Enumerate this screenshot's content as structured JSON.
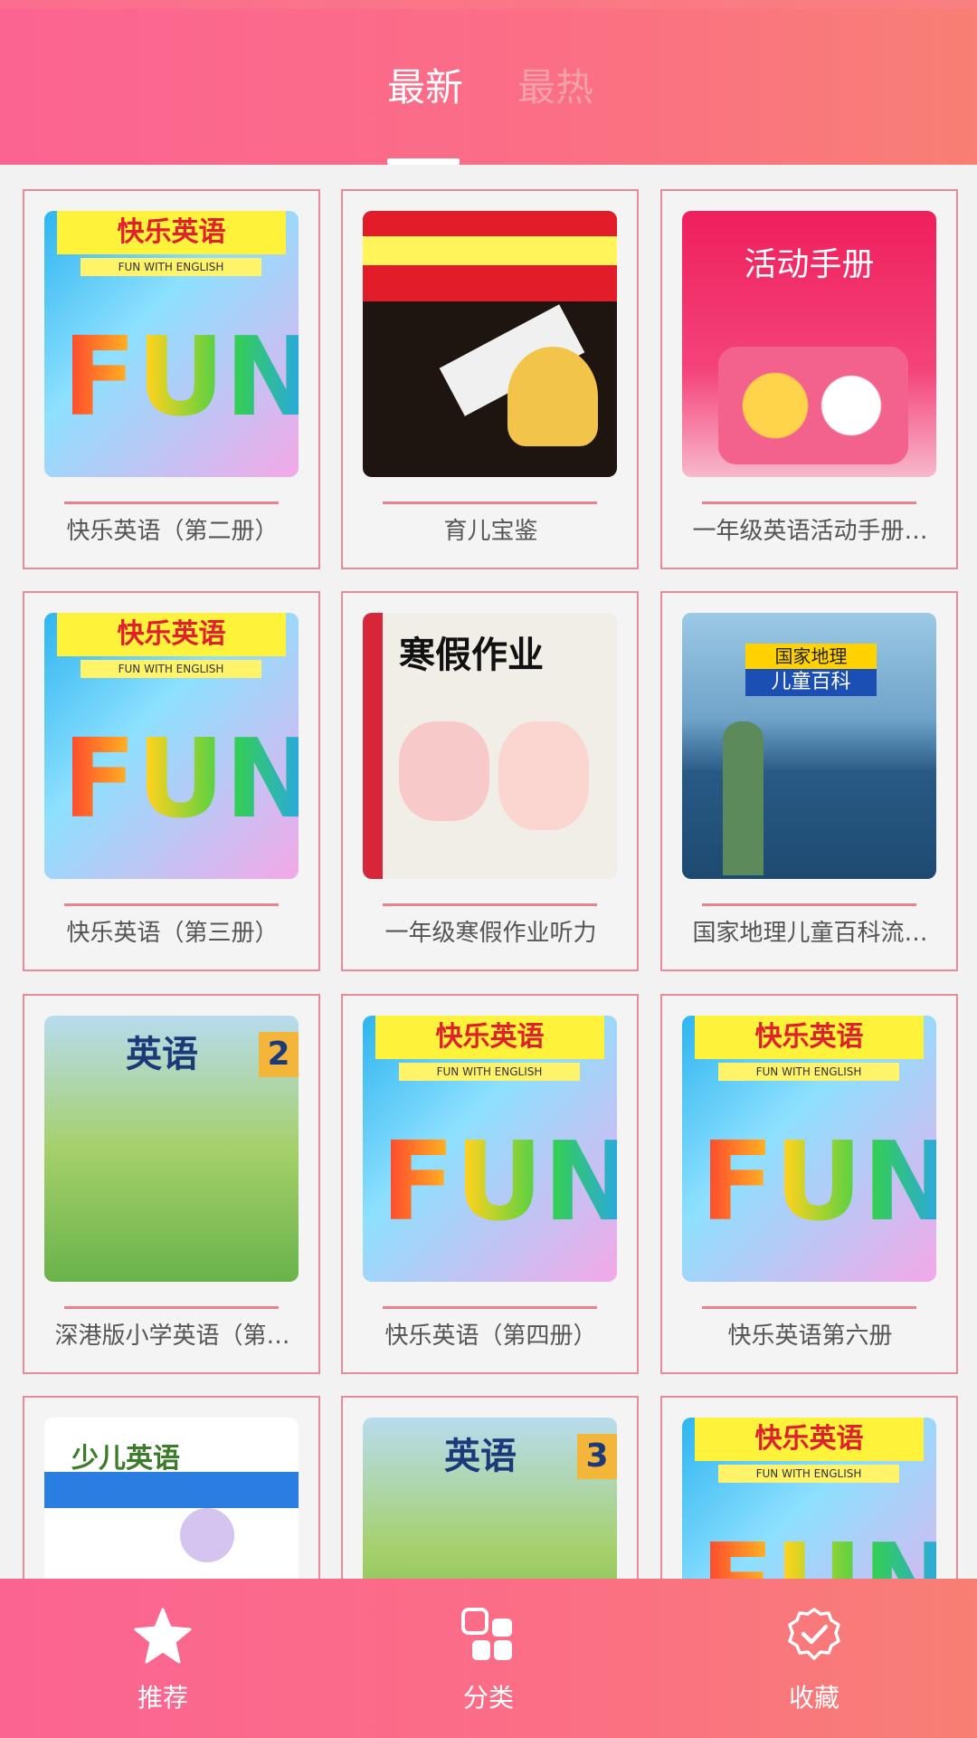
{
  "header": {
    "tabs": [
      {
        "label": "最新",
        "active": true
      },
      {
        "label": "最热",
        "active": false
      }
    ]
  },
  "books": [
    {
      "title": "快乐英语（第二册）",
      "cover": "fun"
    },
    {
      "title": "育儿宝鉴",
      "cover": "baby"
    },
    {
      "title": "一年级英语活动手册…",
      "cover": "activity"
    },
    {
      "title": "快乐英语（第三册）",
      "cover": "fun"
    },
    {
      "title": "一年级寒假作业听力",
      "cover": "homework"
    },
    {
      "title": "国家地理儿童百科流…",
      "cover": "geography"
    },
    {
      "title": "深港版小学英语（第…",
      "cover": "english2"
    },
    {
      "title": "快乐英语（第四册）",
      "cover": "fun"
    },
    {
      "title": "快乐英语第六册",
      "cover": "fun"
    },
    {
      "title": "",
      "cover": "superkids"
    },
    {
      "title": "",
      "cover": "english3"
    },
    {
      "title": "",
      "cover": "fun"
    }
  ],
  "bottom_nav": [
    {
      "label": "推荐",
      "icon": "star-icon",
      "active": true
    },
    {
      "label": "分类",
      "icon": "grid-icon",
      "active": false
    },
    {
      "label": "收藏",
      "icon": "check-badge-icon",
      "active": false
    }
  ],
  "colors": {
    "gradient_start": "#fb6491",
    "gradient_end": "#f87f74",
    "card_border": "#e88a98"
  }
}
